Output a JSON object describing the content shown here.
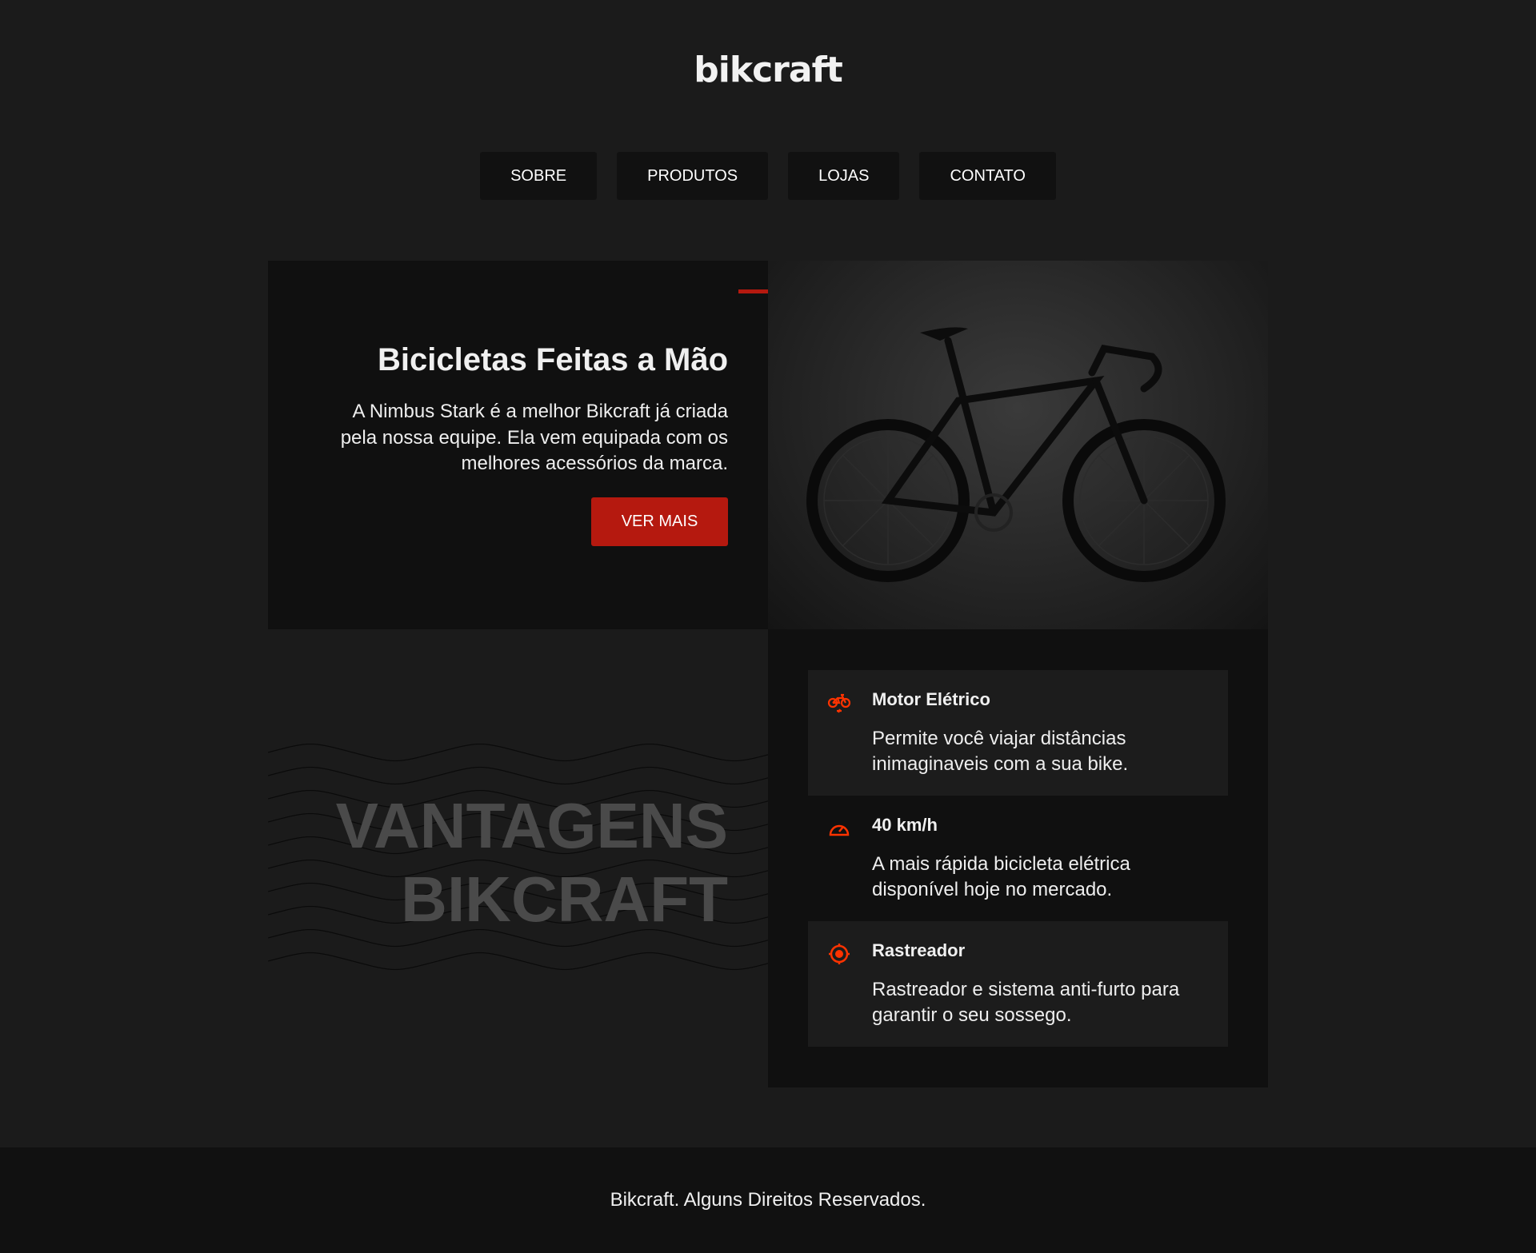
{
  "header": {
    "logo": "bikcraft",
    "nav": [
      "SOBRE",
      "PRODUTOS",
      "LOJAS",
      "CONTATO"
    ]
  },
  "hero": {
    "title": "Bicicletas Feitas a Mão",
    "text": "A Nimbus Stark é a melhor Bikcraft já criada pela nossa equipe. Ela vem equipada com os melhores acessórios da marca.",
    "button": "VER MAIS"
  },
  "advantages": {
    "title_line1": "VANTAGENS",
    "title_line2": "BIKCRAFT",
    "items": [
      {
        "icon": "electric-bike-icon",
        "title": "Motor Elétrico",
        "text": "Permite você viajar distâncias inimaginaveis com a sua bike."
      },
      {
        "icon": "speedometer-icon",
        "title": "40 km/h",
        "text": "A mais rápida bicicleta elétrica disponível hoje no mercado."
      },
      {
        "icon": "target-icon",
        "title": "Rastreador",
        "text": "Rastreador e sistema anti-furto para garantir o seu sossego."
      }
    ]
  },
  "footer": {
    "text": "Bikcraft. Alguns Direitos Reservados."
  },
  "colors": {
    "accent": "#b5190f",
    "icon": "#ff3300",
    "bg": "#1b1b1b"
  }
}
